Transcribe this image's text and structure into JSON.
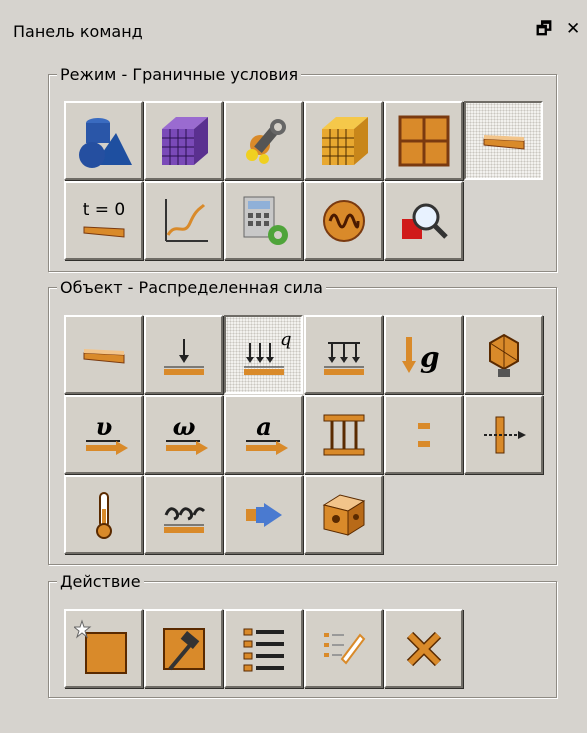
{
  "window": {
    "title": "Панель команд",
    "restore_icon": "restore-icon",
    "close_icon": "close-icon"
  },
  "mode_group": {
    "label": "Режим - Граничные условия",
    "buttons": [
      {
        "name": "geometry-button",
        "icon": "geometry-icon"
      },
      {
        "name": "mesh-button",
        "icon": "mesh-cube-icon"
      },
      {
        "name": "materials-button",
        "icon": "materials-wrench-icon"
      },
      {
        "name": "elements-button",
        "icon": "elements-cube-icon"
      },
      {
        "name": "grid-button",
        "icon": "grid-frame-icon"
      },
      {
        "name": "boundary-conditions-button",
        "icon": "boundary-plate-icon",
        "active": true
      },
      {
        "name": "initial-conditions-button",
        "icon": "initial-conditions-icon",
        "text": "t = 0"
      },
      {
        "name": "graph-button",
        "icon": "graph-icon"
      },
      {
        "name": "calculation-button",
        "icon": "calculator-gear-icon"
      },
      {
        "name": "wave-button",
        "icon": "wave-icon"
      },
      {
        "name": "results-button",
        "icon": "magnifier-icon"
      }
    ]
  },
  "object_group": {
    "label": "Объект - Распределенная сила",
    "buttons": [
      {
        "name": "plate-button",
        "icon": "plate-icon"
      },
      {
        "name": "concentrated-force-button",
        "icon": "point-force-icon"
      },
      {
        "name": "distributed-force-button",
        "icon": "distributed-force-icon",
        "text": "q",
        "active": true
      },
      {
        "name": "pressure-button",
        "icon": "pressure-icon"
      },
      {
        "name": "gravity-button",
        "icon": "gravity-icon",
        "text": "g"
      },
      {
        "name": "rigid-body-button",
        "icon": "rigid-body-icon"
      },
      {
        "name": "velocity-button",
        "icon": "velocity-icon",
        "text": "υ"
      },
      {
        "name": "angular-velocity-button",
        "icon": "angular-velocity-icon",
        "text": "ω"
      },
      {
        "name": "acceleration-button",
        "icon": "acceleration-icon",
        "text": "a"
      },
      {
        "name": "columns-button",
        "icon": "columns-icon"
      },
      {
        "name": "gap-button",
        "icon": "gap-icon"
      },
      {
        "name": "displacement-button",
        "icon": "displacement-icon"
      },
      {
        "name": "temperature-button",
        "icon": "thermometer-icon"
      },
      {
        "name": "convection-button",
        "icon": "convection-icon"
      },
      {
        "name": "flow-button",
        "icon": "flow-arrow-icon"
      },
      {
        "name": "solid-body-button",
        "icon": "solid-cube-icon"
      }
    ]
  },
  "action_group": {
    "label": "Действие",
    "buttons": [
      {
        "name": "new-button",
        "icon": "new-square-icon"
      },
      {
        "name": "build-button",
        "icon": "hammer-icon"
      },
      {
        "name": "list-button",
        "icon": "list-icon"
      },
      {
        "name": "edit-button",
        "icon": "edit-pencil-icon"
      },
      {
        "name": "delete-button",
        "icon": "delete-x-icon"
      }
    ]
  },
  "colors": {
    "panel": "#d6d3ce",
    "accent_orange": "#d98a2a",
    "accent_blue": "#1e4fa0"
  }
}
